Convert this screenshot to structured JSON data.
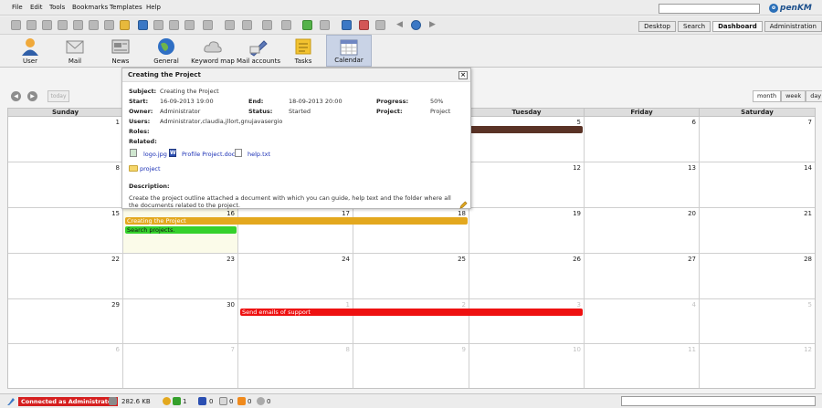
{
  "menu": [
    "File",
    "Edit",
    "Tools",
    "Bookmarks",
    "Templates",
    "Help"
  ],
  "search": {
    "value": "",
    "placeholder": ""
  },
  "logo": {
    "letter": "o",
    "text": "penKM"
  },
  "tabs": [
    {
      "label": "Desktop"
    },
    {
      "label": "Search"
    },
    {
      "label": "Dashboard",
      "active": true
    },
    {
      "label": "Administration"
    }
  ],
  "icon_bar": [
    {
      "label": "User",
      "icon": "user-icon"
    },
    {
      "label": "Mail",
      "icon": "mail-icon"
    },
    {
      "label": "News",
      "icon": "news-icon"
    },
    {
      "label": "General",
      "icon": "globe-icon"
    },
    {
      "label": "Keyword map",
      "icon": "cloud-icon"
    },
    {
      "label": "Mail accounts",
      "icon": "mail-accounts-icon"
    },
    {
      "label": "Tasks",
      "icon": "tasks-icon"
    },
    {
      "label": "Calendar",
      "icon": "calendar-icon",
      "active": true
    }
  ],
  "calendar": {
    "today_label": "today",
    "views": [
      {
        "label": "month",
        "active": true
      },
      {
        "label": "week"
      },
      {
        "label": "day"
      }
    ],
    "day_headers": [
      "Sunday",
      "",
      "",
      "",
      "Tuesday",
      "Friday",
      "Saturday"
    ],
    "weeks": [
      [
        "1",
        "",
        "",
        "",
        "5",
        "6",
        "7"
      ],
      [
        "8",
        "",
        "",
        "",
        "12",
        "13",
        "14"
      ],
      [
        "15",
        "16",
        "17",
        "18",
        "19",
        "20",
        "21"
      ],
      [
        "22",
        "23",
        "24",
        "25",
        "26",
        "27",
        "28"
      ],
      [
        "29",
        "30",
        "1",
        "2",
        "3",
        "4",
        "5"
      ],
      [
        "6",
        "7",
        "8",
        "9",
        "10",
        "11",
        "12"
      ]
    ],
    "events": [
      {
        "title": "",
        "color": "#5a3326"
      },
      {
        "title": "Creating the Project",
        "color": "#e3a81e"
      },
      {
        "title": "Search projects.",
        "color": "#35d12c"
      },
      {
        "title": "Send emails of support",
        "color": "#ee1111"
      }
    ]
  },
  "popup": {
    "title": "Creating the Project",
    "labels": {
      "subject": "Subject:",
      "start": "Start:",
      "end": "End:",
      "progress": "Progress:",
      "owner": "Owner:",
      "status": "Status:",
      "project": "Project:",
      "users": "Users:",
      "roles": "Roles:",
      "related": "Related:",
      "description": "Description:"
    },
    "subject": "Creating the Project",
    "start": "16-09-2013 19:00",
    "end": "18-09-2013 20:00",
    "progress": "50%",
    "owner": "Administrator",
    "status": "Started",
    "project": "Project",
    "users": "Administrator,claudia,jllort,gnujavasergio",
    "roles": "",
    "related": [
      {
        "name": "logo.jpg",
        "icon": "image-file-icon"
      },
      {
        "name": "Profile Project.doc",
        "icon": "word-doc-icon"
      },
      {
        "name": "help.txt",
        "icon": "text-file-icon"
      },
      {
        "name": "project",
        "icon": "folder-icon"
      }
    ],
    "description": "Create the project outline attached a document with which you can guide, help text and the folder where all the documents related to the project.",
    "close_label": "×"
  },
  "status_bar": {
    "connected": "Connected as Administrator",
    "size": "282.6 KB",
    "counts": [
      "1",
      "0",
      "0",
      "0"
    ]
  }
}
